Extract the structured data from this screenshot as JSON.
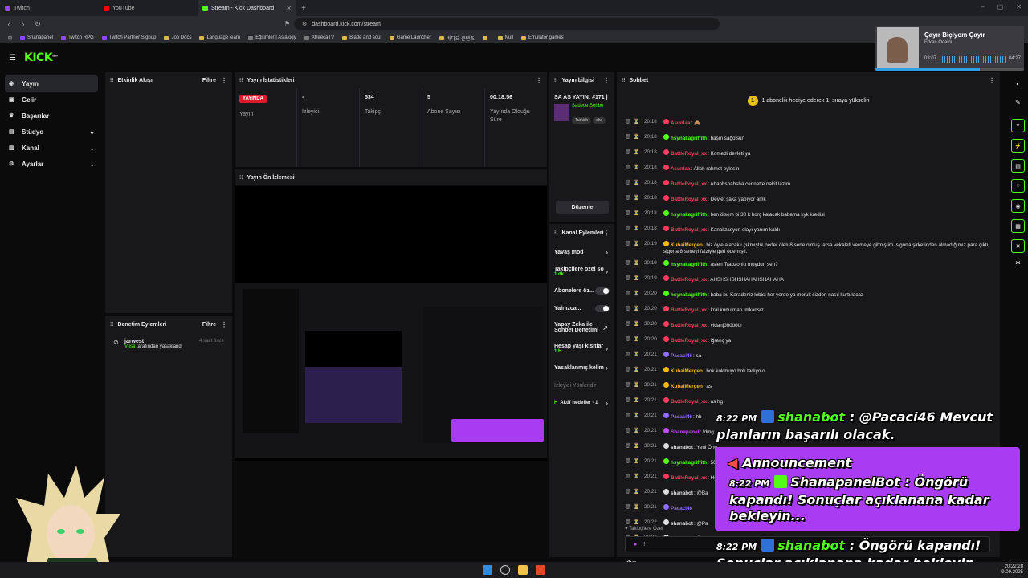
{
  "browser": {
    "tabs": [
      {
        "label": "Twitch",
        "color": "#9146ff"
      },
      {
        "label": "YouTube",
        "color": "#ff0000"
      },
      {
        "label": "Stream - Kick Dashboard",
        "color": "#53fc18"
      }
    ],
    "url": "dashboard.kick.com/stream",
    "bookmarks": [
      "Shanapanel",
      "Twitch RPG",
      "Twitch Partner Signup",
      "Job Docs",
      "Language learn",
      "Eğitimler | Asialogy",
      "AfreecaTV",
      "Blade and soul",
      "Game Launcher",
      "바다오 콘텐츠",
      "",
      "Null",
      "Emulator games"
    ]
  },
  "sidebar": {
    "items": [
      {
        "label": "Yayın",
        "icon": "broadcast-icon",
        "active": true
      },
      {
        "label": "Gelir",
        "icon": "revenue-icon"
      },
      {
        "label": "Başarılar",
        "icon": "trophy-icon"
      },
      {
        "label": "Stüdyo",
        "icon": "studio-icon",
        "expandable": true
      },
      {
        "label": "Kanal",
        "icon": "channel-icon",
        "expandable": true
      },
      {
        "label": "Ayarlar",
        "icon": "gear-icon",
        "expandable": true
      }
    ]
  },
  "activity": {
    "title": "Etkinlik Akışı",
    "filter": "Filtre"
  },
  "stats": {
    "title": "Yayın İstatistikleri",
    "items": [
      {
        "value": "YAYINDA",
        "label": "Yayın"
      },
      {
        "value": "-",
        "label": "İzleyici"
      },
      {
        "value": "534",
        "label": "Takipçi"
      },
      {
        "value": "5",
        "label": "Abone Sayısı"
      },
      {
        "value": "00:18:56",
        "label": "Yayında Olduğu Süre"
      }
    ]
  },
  "preview": {
    "title": "Yayın Ön İzlemesi"
  },
  "info": {
    "title": "Yayın bilgisi",
    "stream_title": "SA AS YAYIN: #171 |",
    "category": "Sadece Sohbe",
    "tags": [
      "Turkish",
      "sha"
    ],
    "edit": "Düzenle"
  },
  "actions": {
    "title": "Kanal Eylemleri",
    "items": [
      {
        "label": "Yavaş mod",
        "type": "arrow"
      },
      {
        "label": "Takipçilere özel so",
        "sub": "1 dk.",
        "type": "arrow"
      },
      {
        "label": "Abonelere öz...",
        "type": "toggle"
      },
      {
        "label": "Yalnızca...",
        "type": "toggle"
      },
      {
        "label": "Yapay Zeka ile Sohbet Denetimi",
        "type": "toggle"
      },
      {
        "label": "Hesap yaşı kısıtlar",
        "sub": "1 H.",
        "type": "arrow"
      },
      {
        "label": "Yasaklanmış kelim",
        "type": "arrow"
      },
      {
        "label": "İzleyici Yönlendir",
        "type": "none"
      },
      {
        "label": "Aktif hedefler · 1",
        "type": "arrow"
      }
    ]
  },
  "moderation": {
    "title": "Denetim Eylemleri",
    "filter": "Filtre",
    "entry": {
      "user": "jarwest",
      "who": "VIisa",
      "rest": " tarafından yasaklandı",
      "time": "4 saat önce"
    }
  },
  "chat": {
    "title": "Sohbet",
    "banner": "1 abonelik hediye ederek 1. sıraya yükselin",
    "banner_rank": "1",
    "messages": [
      {
        "time": "20:18",
        "user": "Asunlaa",
        "color": "#ff3b5c",
        "text": ": 🙈"
      },
      {
        "time": "20:18",
        "user": "hsynakagriffith",
        "color": "#53fc18",
        "text": ": başın sağolsun"
      },
      {
        "time": "20:18",
        "user": "BattleRoyal_xx",
        "color": "#ff3b5c",
        "text": ": Komedi devleti ya"
      },
      {
        "time": "20:18",
        "user": "Asunlaa",
        "color": "#ff3b5c",
        "text": ": Allah rahmet eylesin"
      },
      {
        "time": "20:18",
        "user": "BattleRoyal_xx",
        "color": "#ff3b5c",
        "text": ": Ahahhshahsha cennette nakit lazım"
      },
      {
        "time": "20:18",
        "user": "BattleRoyal_xx",
        "color": "#ff3b5c",
        "text": ": Devlet şaka yapıyor amk"
      },
      {
        "time": "20:18",
        "user": "hsynakagriffith",
        "color": "#53fc18",
        "text": ": ben ölsem bi 30 k borç kalacak babama kyk kredisi"
      },
      {
        "time": "20:18",
        "user": "BattleRoyal_xx",
        "color": "#ff3b5c",
        "text": ": Kanalizasyon olayı yanım kaldı"
      },
      {
        "time": "20:19",
        "user": "KubaiMergen",
        "color": "#f5b800",
        "text": ": biz öyle alacaklı çıkmıştık peder ölelı 8 sene olmuş. arsa vekaleti vermeye gitmiştim. sigorta şirketinden almadığımız para çıktı. sigorta 8 seneyi faiziyle geri ödemişti.",
        "wrap": true
      },
      {
        "time": "20:19",
        "user": "hsynakagriffith",
        "color": "#53fc18",
        "text": ": aslen Trabzonlu muydun sen?"
      },
      {
        "time": "20:19",
        "user": "BattleRoyal_xx",
        "color": "#ff3b5c",
        "text": ": AHSHSHSHSHAHAHSHAHAHA"
      },
      {
        "time": "20:20",
        "user": "hsynakagriffith",
        "color": "#53fc18",
        "text": ": baba bu Karadeniz lobisi her yerde ya moruk sizden nasıl kurtulacaz"
      },
      {
        "time": "20:20",
        "user": "BattleRoyal_xx",
        "color": "#ff3b5c",
        "text": ": kral kurtulman imkansız"
      },
      {
        "time": "20:20",
        "user": "BattleRoyal_xx",
        "color": "#ff3b5c",
        "text": ": vidanjöööööör"
      },
      {
        "time": "20:20",
        "user": "BattleRoyal_xx",
        "color": "#ff3b5c",
        "text": ": iğrenç ya"
      },
      {
        "time": "20:21",
        "user": "Pacaci46",
        "color": "#8f6bff",
        "text": ": sa"
      },
      {
        "time": "20:21",
        "user": "KubaiMergen",
        "color": "#f5b800",
        "text": ": bok kokmuyo bok tadıyo o"
      },
      {
        "time": "20:21",
        "user": "KubaiMergen",
        "color": "#f5b800",
        "text": ": as"
      },
      {
        "time": "20:21",
        "user": "BattleRoyal_xx",
        "color": "#ff3b5c",
        "text": ": as hg"
      },
      {
        "time": "20:21",
        "user": "Pacaci46",
        "color": "#8f6bff",
        "text": ": hb"
      },
      {
        "time": "20:21",
        "user": "Shanapanel",
        "color": "#c04bff",
        "text": ": !dmg"
      },
      {
        "time": "20:21",
        "user": "shanabot",
        "color": "#dddddd",
        "text": ": Yeni Öng"
      },
      {
        "time": "20:21",
        "user": "hsynakagriffith",
        "color": "#53fc18",
        "text": ": 50"
      },
      {
        "time": "20:21",
        "user": "BattleRoyal_xx",
        "color": "#ff3b5c",
        "text": ": Hei"
      },
      {
        "time": "20:21",
        "user": "shanabot",
        "color": "#dddddd",
        "text": ": @Ba"
      },
      {
        "time": "20:21",
        "user": "Pacaci46",
        "color": "#8f6bff",
        "text": ""
      },
      {
        "time": "20:22",
        "user": "shanabot",
        "color": "#dddddd",
        "text": ": @Pa"
      },
      {
        "time": "20:22",
        "user": "shanabot",
        "color": "#dddddd",
        "text": ": Öng"
      }
    ],
    "followers_only": "Takipçilere Özel",
    "input_value": "!"
  },
  "music": {
    "title": "Çayır Biçiyom Çayır",
    "artist": "Erkan Ocaklı",
    "current": "03:07",
    "total": "04:27",
    "progress": 0.7
  },
  "overlay": {
    "line1_time": "8:22 PM",
    "line1_name": "shanabot",
    "line1_text": " : @Pacaci46 Mevcut planların başarılı olacak.",
    "announce_title": "Announcement",
    "announce_time": "8:22 PM",
    "announce_name": "ShanapanelBot",
    "announce_text": " : Öngörü kapandı! Sonuçlar açıklanana kadar bekleyin...",
    "line3_time": "8:22 PM",
    "line3_name": "shanabot",
    "line3_text": " : Öngörü kapandı! Sonuçlar açıklanana kadar bekleyin..."
  },
  "clock": {
    "time": "20:22:28",
    "date": "9.09.2025"
  }
}
